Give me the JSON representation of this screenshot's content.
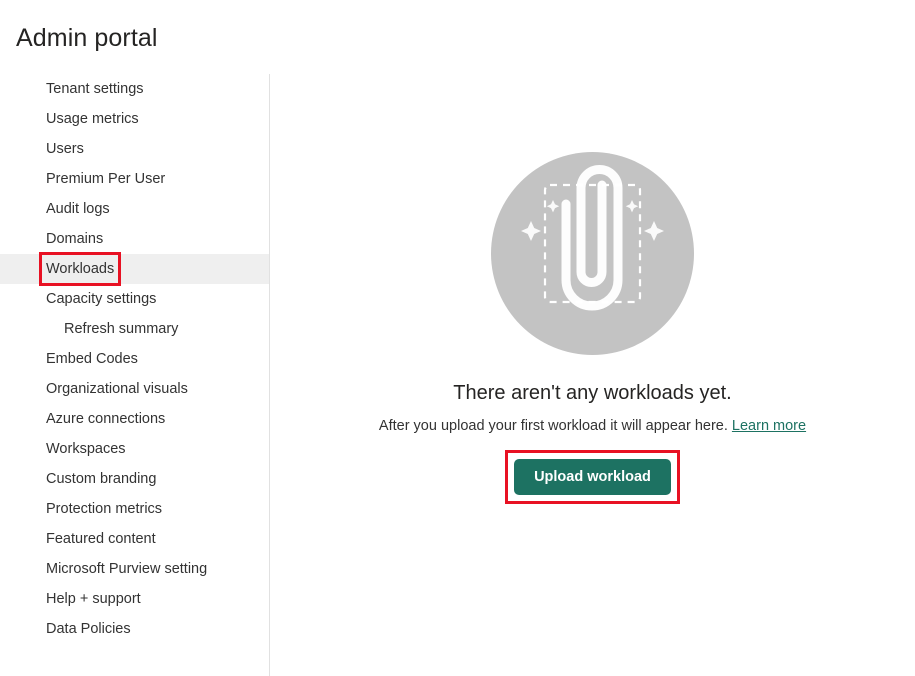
{
  "page": {
    "title": "Admin portal"
  },
  "sidebar": {
    "items": [
      {
        "label": "Tenant settings",
        "sub": false,
        "selected": false,
        "highlighted": false
      },
      {
        "label": "Usage metrics",
        "sub": false,
        "selected": false,
        "highlighted": false
      },
      {
        "label": "Users",
        "sub": false,
        "selected": false,
        "highlighted": false
      },
      {
        "label": "Premium Per User",
        "sub": false,
        "selected": false,
        "highlighted": false
      },
      {
        "label": "Audit logs",
        "sub": false,
        "selected": false,
        "highlighted": false
      },
      {
        "label": "Domains",
        "sub": false,
        "selected": false,
        "highlighted": false
      },
      {
        "label": "Workloads",
        "sub": false,
        "selected": true,
        "highlighted": true
      },
      {
        "label": "Capacity settings",
        "sub": false,
        "selected": false,
        "highlighted": false
      },
      {
        "label": "Refresh summary",
        "sub": true,
        "selected": false,
        "highlighted": false
      },
      {
        "label": "Embed Codes",
        "sub": false,
        "selected": false,
        "highlighted": false
      },
      {
        "label": "Organizational visuals",
        "sub": false,
        "selected": false,
        "highlighted": false
      },
      {
        "label": "Azure connections",
        "sub": false,
        "selected": false,
        "highlighted": false
      },
      {
        "label": "Workspaces",
        "sub": false,
        "selected": false,
        "highlighted": false
      },
      {
        "label": "Custom branding",
        "sub": false,
        "selected": false,
        "highlighted": false
      },
      {
        "label": "Protection metrics",
        "sub": false,
        "selected": false,
        "highlighted": false
      },
      {
        "label": "Featured content",
        "sub": false,
        "selected": false,
        "highlighted": false
      },
      {
        "label": "Microsoft Purview setting",
        "sub": false,
        "selected": false,
        "highlighted": false
      },
      {
        "label": "Help + support",
        "sub": false,
        "selected": false,
        "highlighted": false
      },
      {
        "label": "Data Policies",
        "sub": false,
        "selected": false,
        "highlighted": false
      }
    ]
  },
  "empty_state": {
    "illustration_icon": "paperclip-upload-illustration",
    "title": "There aren't any workloads yet.",
    "subtitle": "After you upload your first workload it will appear here.",
    "learn_more_label": "Learn more",
    "upload_button_label": "Upload workload"
  },
  "colors": {
    "accent_teal": "#1d7262",
    "annotation_red": "#e81123",
    "selected_row": "#efefef",
    "illustration_circle": "#c3c3c3",
    "divider": "#e1e1e1",
    "text_primary": "#252423",
    "text_body": "#333333"
  }
}
